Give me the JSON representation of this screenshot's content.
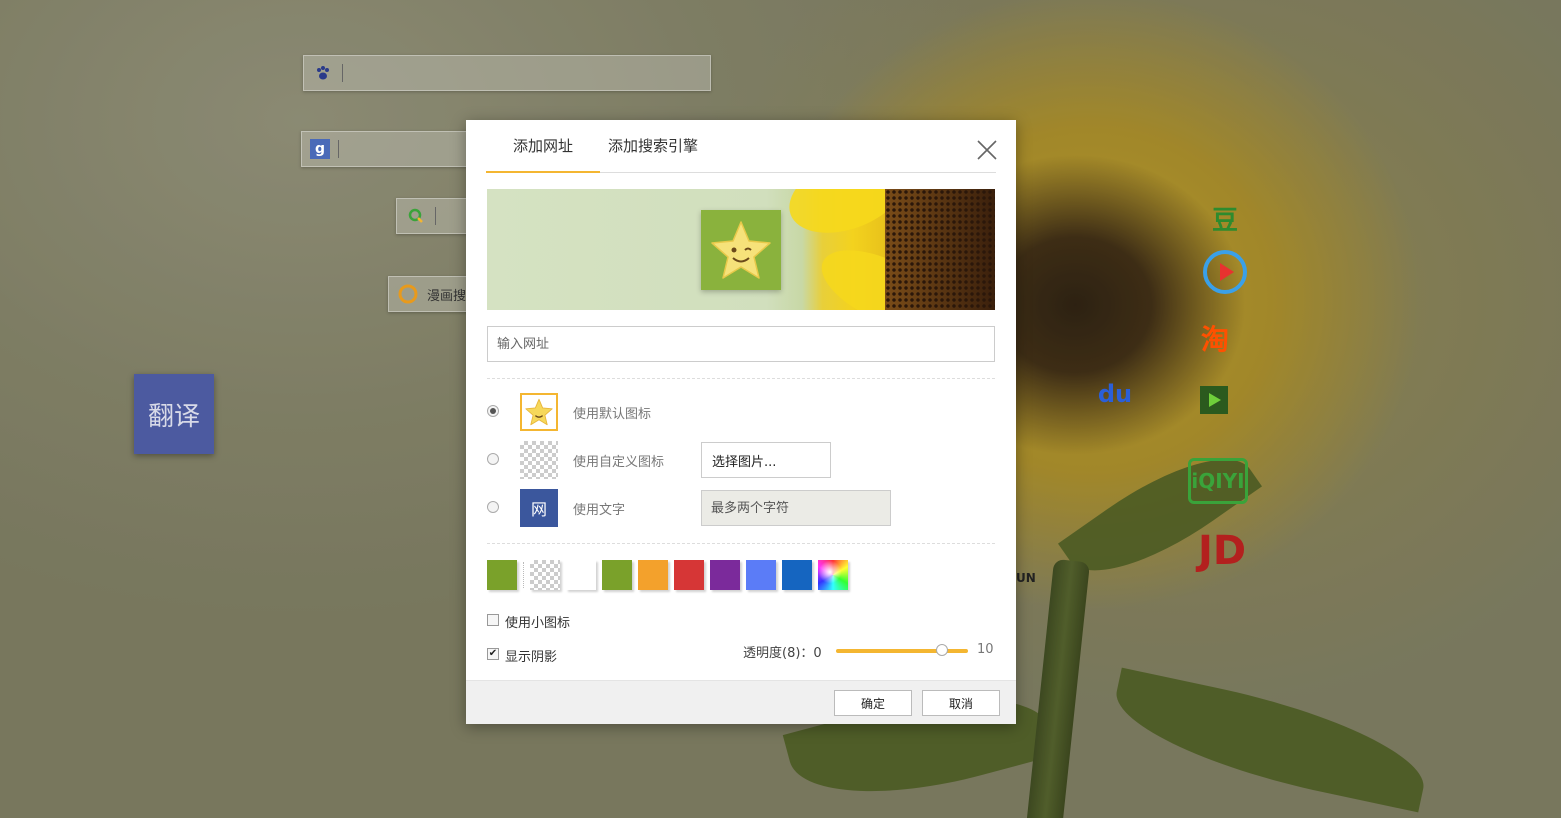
{
  "background": {
    "search_bars": [
      {
        "icon": "baidu-paw-icon",
        "text": ""
      },
      {
        "icon": "google-g-icon",
        "text": ""
      },
      {
        "icon": "so-search-icon",
        "text": ""
      },
      {
        "icon": "comic-search-icon",
        "text": "漫画搜"
      }
    ],
    "translate_tile": "翻译",
    "right_icons": [
      {
        "name": "douban-icon",
        "label": "豆",
        "color": "#2e8b2e"
      },
      {
        "name": "youku-icon",
        "label": "▶",
        "color": "#e8322f"
      },
      {
        "name": "taobao-icon",
        "label": "淘",
        "color": "#ff5000"
      },
      {
        "name": "video-icon",
        "label": "▶",
        "color": "#3a8f2a"
      },
      {
        "name": "baidu-du-icon",
        "label": "du",
        "color": "#2b5fd8"
      },
      {
        "name": "iqiyi-icon",
        "label": "iQIYI",
        "color": "#3aa33a"
      },
      {
        "name": "jd-icon",
        "label": "JD",
        "color": "#b3201e"
      }
    ],
    "partial_text": "UN"
  },
  "dialog": {
    "tabs": [
      {
        "label": "添加网址",
        "active": true
      },
      {
        "label": "添加搜索引擎",
        "active": false
      }
    ],
    "url_placeholder": "输入网址",
    "icon_options": [
      {
        "label": "使用默认图标",
        "checked": true
      },
      {
        "label": "使用自定义图标",
        "checked": false
      },
      {
        "label": "使用文字",
        "checked": false
      }
    ],
    "choose_image_label": "选择图片...",
    "text_icon_char": "网",
    "text_input_placeholder": "最多两个字符",
    "swatches": [
      "#7aa12a",
      "checker",
      "#ffffff",
      "#7aa12a",
      "#f3a12c",
      "#d63636",
      "#7b2a9b",
      "#5b7cf7",
      "#1565c0",
      "spectrum"
    ],
    "small_icon_label": "使用小图标",
    "small_icon_checked": false,
    "shadow_label": "显示阴影",
    "shadow_checked": true,
    "opacity_label": "透明度(8)：0",
    "opacity_value": 8,
    "opacity_min": 0,
    "opacity_max": 10,
    "opacity_max_label": "10",
    "confirm_label": "确定",
    "cancel_label": "取消",
    "accent_color": "#f4b631"
  }
}
